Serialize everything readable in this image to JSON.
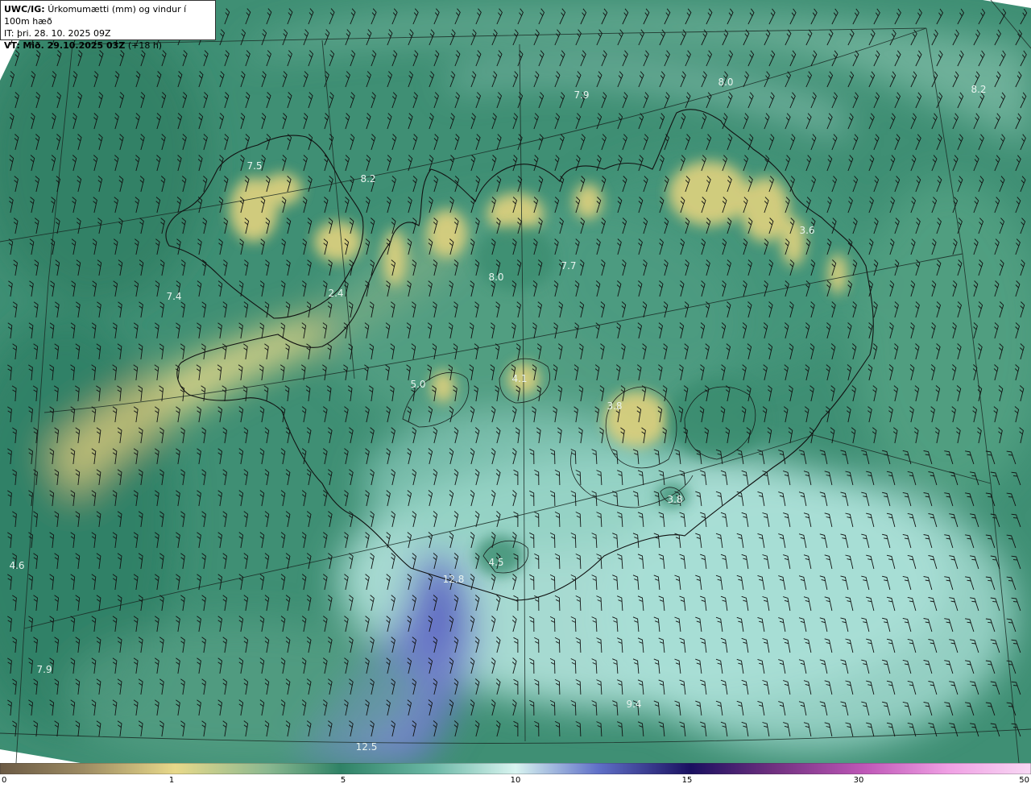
{
  "header": {
    "product": "UWC/IG:",
    "title": "Úrkomumætti (mm) og vindur í 100m hæð",
    "it_label": "IT:",
    "it_value": "þri. 28. 10. 2025 09Z",
    "vt_label": "VT:",
    "vt_value": "Mið. 29.10.2025 03Z",
    "vt_offset": "(+18 h)"
  },
  "colorbar": {
    "ticks": [
      "0",
      "1",
      "5",
      "10",
      "15",
      "30",
      "50"
    ],
    "tick_values": [
      0,
      1,
      5,
      10,
      15,
      30,
      50
    ],
    "colors": [
      "#6b5a44",
      "#b09a6a",
      "#e6d98a",
      "#5fa07e",
      "#2f8a6c",
      "#a8d8d0",
      "#c8f0ee",
      "#4050b0",
      "#1a1a7a",
      "#803090",
      "#e080d8",
      "#f4c8f0"
    ]
  },
  "value_labels": [
    {
      "text": "7.9",
      "v": 7.9
    },
    {
      "text": "8.0",
      "v": 8.0
    },
    {
      "text": "8.2",
      "v": 8.2
    },
    {
      "text": "7.5",
      "v": 7.5
    },
    {
      "text": "8.2",
      "v": 8.2
    },
    {
      "text": "3.6",
      "v": 3.6
    },
    {
      "text": "7.7",
      "v": 7.7
    },
    {
      "text": "8.0",
      "v": 8.0
    },
    {
      "text": "7.4",
      "v": 7.4
    },
    {
      "text": "2.4",
      "v": 2.4
    },
    {
      "text": "4.1",
      "v": 4.1
    },
    {
      "text": "5.0",
      "v": 5.0
    },
    {
      "text": "3.8",
      "v": 3.8
    },
    {
      "text": "3.8",
      "v": 3.8
    },
    {
      "text": "4.5",
      "v": 4.5
    },
    {
      "text": "12.8",
      "v": 12.8
    },
    {
      "text": "4.6",
      "v": 4.6
    },
    {
      "text": "7.9",
      "v": 7.9
    },
    {
      "text": "12.5",
      "v": 12.5
    },
    {
      "text": "9.4",
      "v": 9.4
    }
  ]
}
